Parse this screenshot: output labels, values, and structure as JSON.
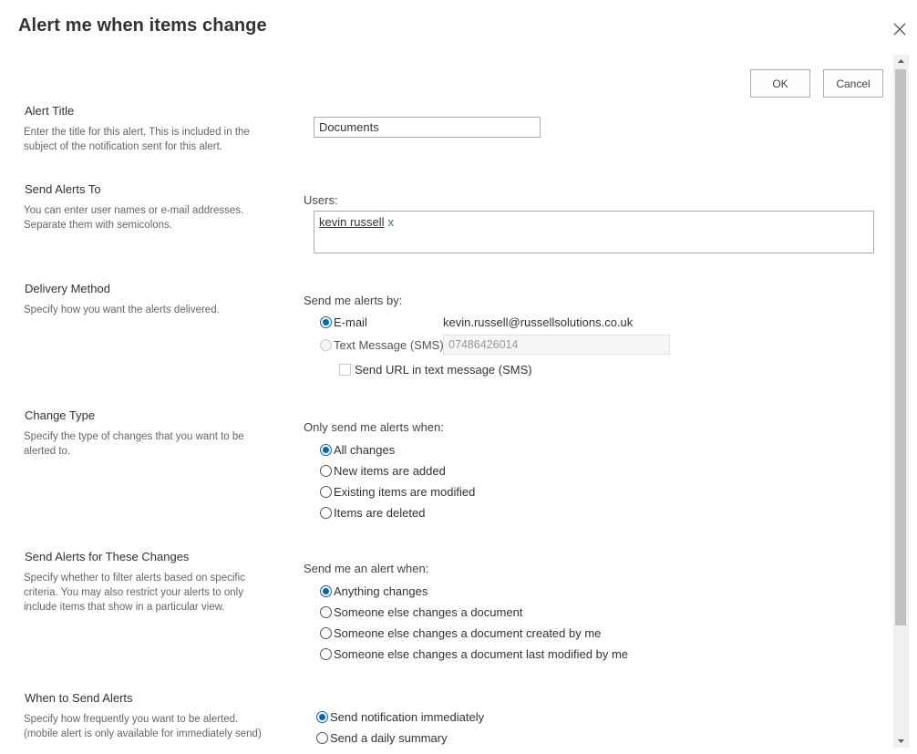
{
  "dialog": {
    "title": "Alert me when items change"
  },
  "buttons": {
    "ok": "OK",
    "cancel": "Cancel"
  },
  "alert_title": {
    "heading": "Alert Title",
    "description": "Enter the title for this alert. This is included in the subject of the notification sent for this alert.",
    "value": "Documents"
  },
  "send_to": {
    "heading": "Send Alerts To",
    "description": "You can enter user names or e-mail addresses. Separate them with semicolons.",
    "users_label": "Users:",
    "user": "kevin russell",
    "remove": "x"
  },
  "delivery": {
    "heading": "Delivery Method",
    "description": "Specify how you want the alerts delivered.",
    "label": "Send me alerts by:",
    "email_option": "E-mail",
    "email_value": "kevin.russell@russellsolutions.co.uk",
    "sms_option": "Text Message (SMS)",
    "sms_value": "07486426014",
    "sms_url_option": "Send URL in text message (SMS)"
  },
  "change_type": {
    "heading": "Change Type",
    "description": "Specify the type of changes that you want to be alerted to.",
    "label": "Only send me alerts when:",
    "options": [
      "All changes",
      "New items are added",
      "Existing items are modified",
      "Items are deleted"
    ]
  },
  "filter": {
    "heading": "Send Alerts for These Changes",
    "description": "Specify whether to filter alerts based on specific criteria. You may also restrict your alerts to only include items that show in a particular view.",
    "label": "Send me an alert when:",
    "options": [
      "Anything changes",
      "Someone else changes a document",
      "Someone else changes a document created by me",
      "Someone else changes a document last modified by me"
    ]
  },
  "frequency": {
    "heading": "When to Send Alerts",
    "description": "Specify how frequently you want to be alerted. (mobile alert is only available for immediately send)",
    "options": [
      "Send notification immediately",
      "Send a daily summary"
    ]
  },
  "colors": {
    "accent": "#0067b8",
    "remove_link": "#2b7a6b"
  }
}
